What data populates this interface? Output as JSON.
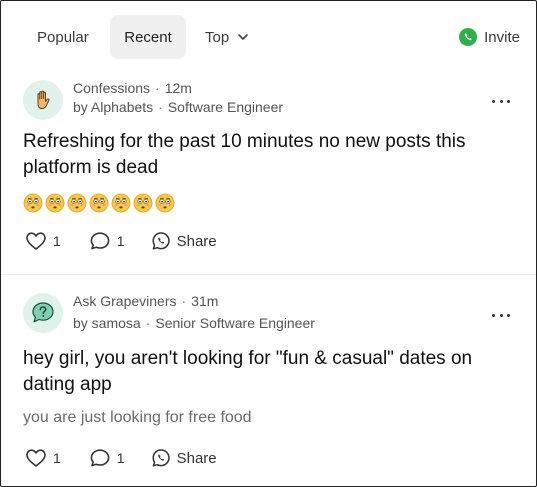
{
  "header": {
    "tabs": [
      {
        "label": "Popular"
      },
      {
        "label": "Recent"
      },
      {
        "label": "Top"
      }
    ],
    "active_tab": "Recent",
    "invite_label": "Invite"
  },
  "posts": [
    {
      "channel": "Confessions",
      "time": "12m",
      "by": "by Alphabets",
      "role": "Software Engineer",
      "avatar_icon": "raised-hand-icon",
      "title": "Refreshing for the past 10 minutes no new posts this platform is dead",
      "emoji_icon": "flushed-face-icon",
      "emoji_count": 7,
      "likes": "1",
      "comments": "1",
      "share_label": "Share"
    },
    {
      "channel": "Ask Grapeviners",
      "time": "31m",
      "by": "by samosa",
      "role": "Senior Software Engineer",
      "avatar_icon": "question-speech-bubble-icon",
      "title": "hey girl, you aren't looking for \"fun & casual\" dates on dating app",
      "body": "you are just looking for free food",
      "likes": "1",
      "comments": "1",
      "share_label": "Share"
    }
  ],
  "colors": {
    "accent_green": "#2fb14a",
    "avatar_bg": "#dff3ea",
    "active_tab_bg": "#f0f0f0"
  }
}
